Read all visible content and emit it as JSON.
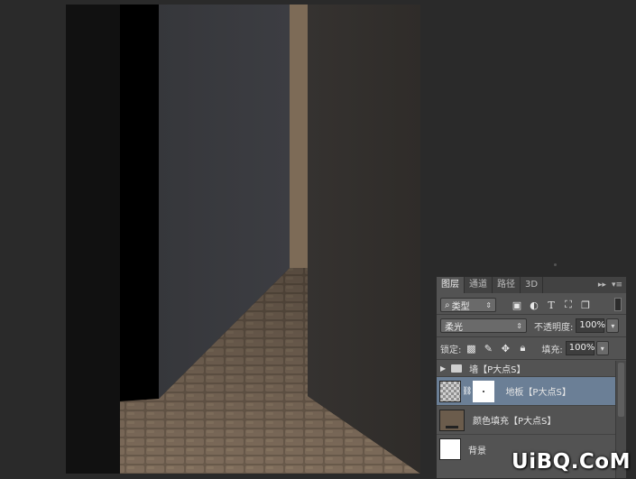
{
  "layers_panel": {
    "tabs": [
      "图层",
      "通道",
      "路径",
      "3D"
    ],
    "menu_icons": [
      "expand-icon",
      "panel-menu-icon"
    ],
    "filter": {
      "kind_label": "类型",
      "filter_icons": [
        "image-filter-icon",
        "adjustment-filter-icon",
        "type-filter-icon",
        "shape-filter-icon",
        "smart-object-filter-icon"
      ]
    },
    "blend_mode": "柔光",
    "opacity_label": "不透明度:",
    "opacity_value": "100%",
    "lock_label": "锁定:",
    "lock_icons": [
      "lock-transparent-icon",
      "lock-paint-icon",
      "lock-position-icon",
      "lock-all-icon"
    ],
    "fill_label": "填充:",
    "fill_value": "100%",
    "layers": [
      {
        "name": "墙【P大点S】",
        "type": "group"
      },
      {
        "name": "地板【P大点S】",
        "type": "pixel-with-mask",
        "selected": true
      },
      {
        "name": "颜色填充【P大点S】",
        "type": "fill"
      },
      {
        "name": "背景",
        "type": "background"
      }
    ]
  },
  "watermark": "UiBQ.CoM",
  "colors": {
    "workspace": "#2a2a2a",
    "panel": "#535353",
    "selected_layer": "#6b7f96",
    "left_wall": "#393a3e",
    "right_wall": "#322f2b",
    "corridor_light": "#7d6b57",
    "floor": "#6e5f4f"
  }
}
